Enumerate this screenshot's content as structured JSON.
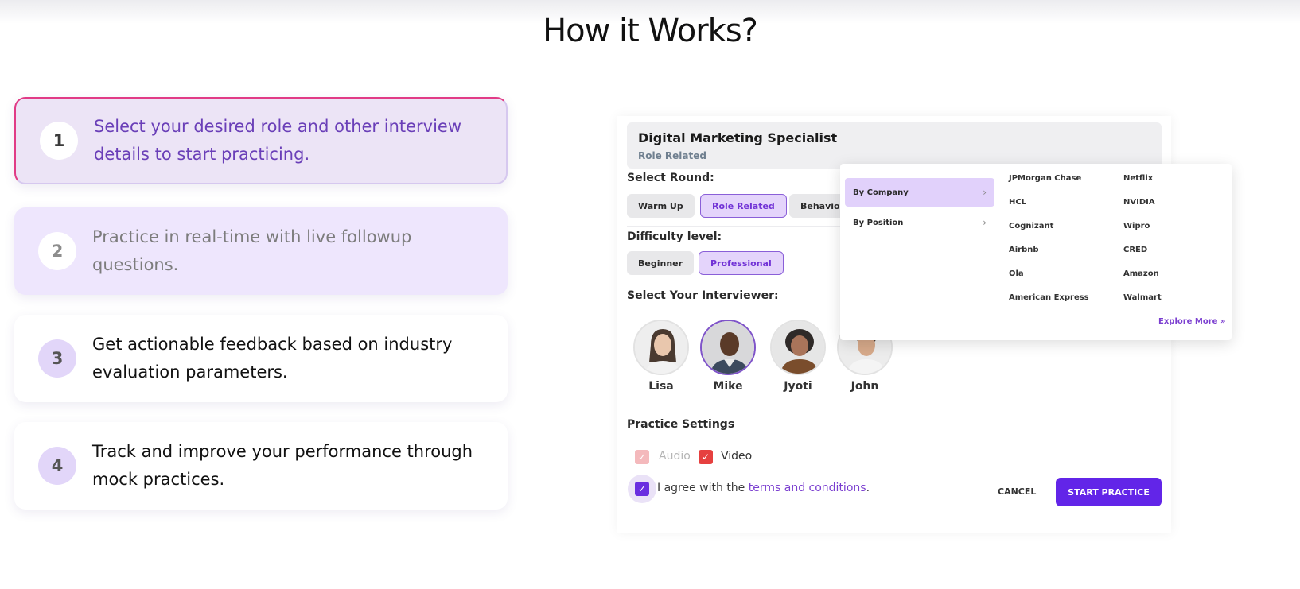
{
  "heading": "How it Works?",
  "steps": [
    {
      "number": "1",
      "text": "Select your desired role and other interview details to start practicing."
    },
    {
      "number": "2",
      "text": "Practice in real-time with live followup questions."
    },
    {
      "number": "3",
      "text": "Get actionable feedback based on industry evaluation parameters."
    },
    {
      "number": "4",
      "text": "Track and improve your performance through mock practices."
    }
  ],
  "panel": {
    "role_title": "Digital Marketing Specialist",
    "role_subtitle": "Role Related",
    "select_round_label": "Select Round:",
    "rounds": [
      "Warm Up",
      "Role Related",
      "Behavior"
    ],
    "selected_round": "Role Related",
    "difficulty_label": "Difficulty level:",
    "difficulties": [
      "Beginner",
      "Professional"
    ],
    "selected_difficulty": "Professional",
    "interviewer_label": "Select Your Interviewer:",
    "interviewers": [
      "Lisa",
      "Mike",
      "Jyoti",
      "John"
    ],
    "selected_interviewer": "Mike",
    "practice_settings_label": "Practice Settings",
    "audio_label": "Audio",
    "video_label": "Video",
    "agree_prefix": "I agree with the ",
    "agree_link": "terms and conditions",
    "agree_suffix": ".",
    "cancel_label": "CANCEL",
    "start_label": "START PRACTICE"
  },
  "dropdown": {
    "categories": [
      {
        "label": "By Company",
        "active": true
      },
      {
        "label": "By Position",
        "active": false
      }
    ],
    "companies_col1": [
      "JPMorgan Chase",
      "HCL",
      "Cognizant",
      "Airbnb",
      "Ola",
      "American Express"
    ],
    "companies_col2": [
      "Netflix",
      "NVIDIA",
      "Wipro",
      "CRED",
      "Amazon",
      "Walmart"
    ],
    "explore_more": "Explore More »"
  },
  "colors": {
    "accent": "#6225e8",
    "accent_light": "#e4d4fb",
    "active_border": "#e13b86",
    "video_checkbox": "#e6403f"
  },
  "icons": {
    "check": "check-icon",
    "chevron": "chevron-right-icon"
  }
}
